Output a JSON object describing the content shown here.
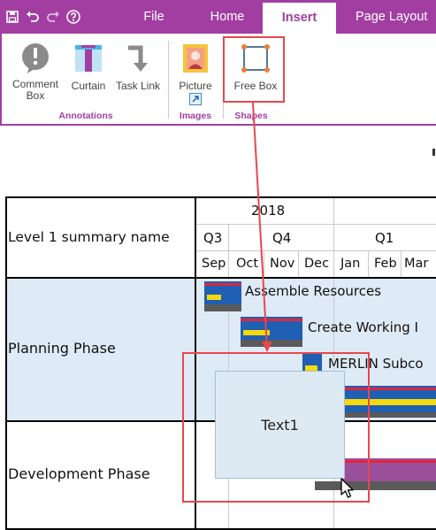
{
  "ribbon": {
    "tabs": {
      "file": "File",
      "home": "Home",
      "insert": "Insert",
      "page_layout": "Page Layout"
    },
    "quick_access": [
      "save-icon",
      "undo-icon",
      "redo-icon",
      "help-icon"
    ],
    "groups": {
      "annotations": {
        "label": "Annotations",
        "buttons": {
          "comment_line1": "Comment",
          "comment_line2": "Box",
          "curtain": "Curtain",
          "task_link": "Task Link"
        }
      },
      "images": {
        "label": "Images",
        "buttons": {
          "picture": "Picture"
        }
      },
      "shapes": {
        "label": "Shapes",
        "buttons": {
          "free_box": "Free Box"
        }
      }
    }
  },
  "colors": {
    "accent": "#a23ea2",
    "callout": "#e5484d",
    "band": "#deeaf6",
    "bar_blue": "#1f5fb4",
    "bar_yellow": "#f5d90a",
    "bar_red": "#e0263a",
    "bar_gray": "#5a5a5a",
    "bar_purple": "#9b4f9b"
  },
  "gantt": {
    "header": {
      "row_label": "Level 1 summary name",
      "year": "2018",
      "quarters": [
        "Q3",
        "Q4",
        "Q1"
      ],
      "months": [
        "Sep",
        "Oct",
        "Nov",
        "Dec",
        "Jan",
        "Feb",
        "Mar"
      ]
    },
    "phases": [
      {
        "name": "Planning Phase"
      },
      {
        "name": "Development Phase"
      }
    ],
    "tasks": {
      "assemble": "Assemble Resources",
      "create": "Create Working I",
      "merlin": "MERLIN Subco"
    }
  },
  "freebox": {
    "text": "Text1"
  }
}
